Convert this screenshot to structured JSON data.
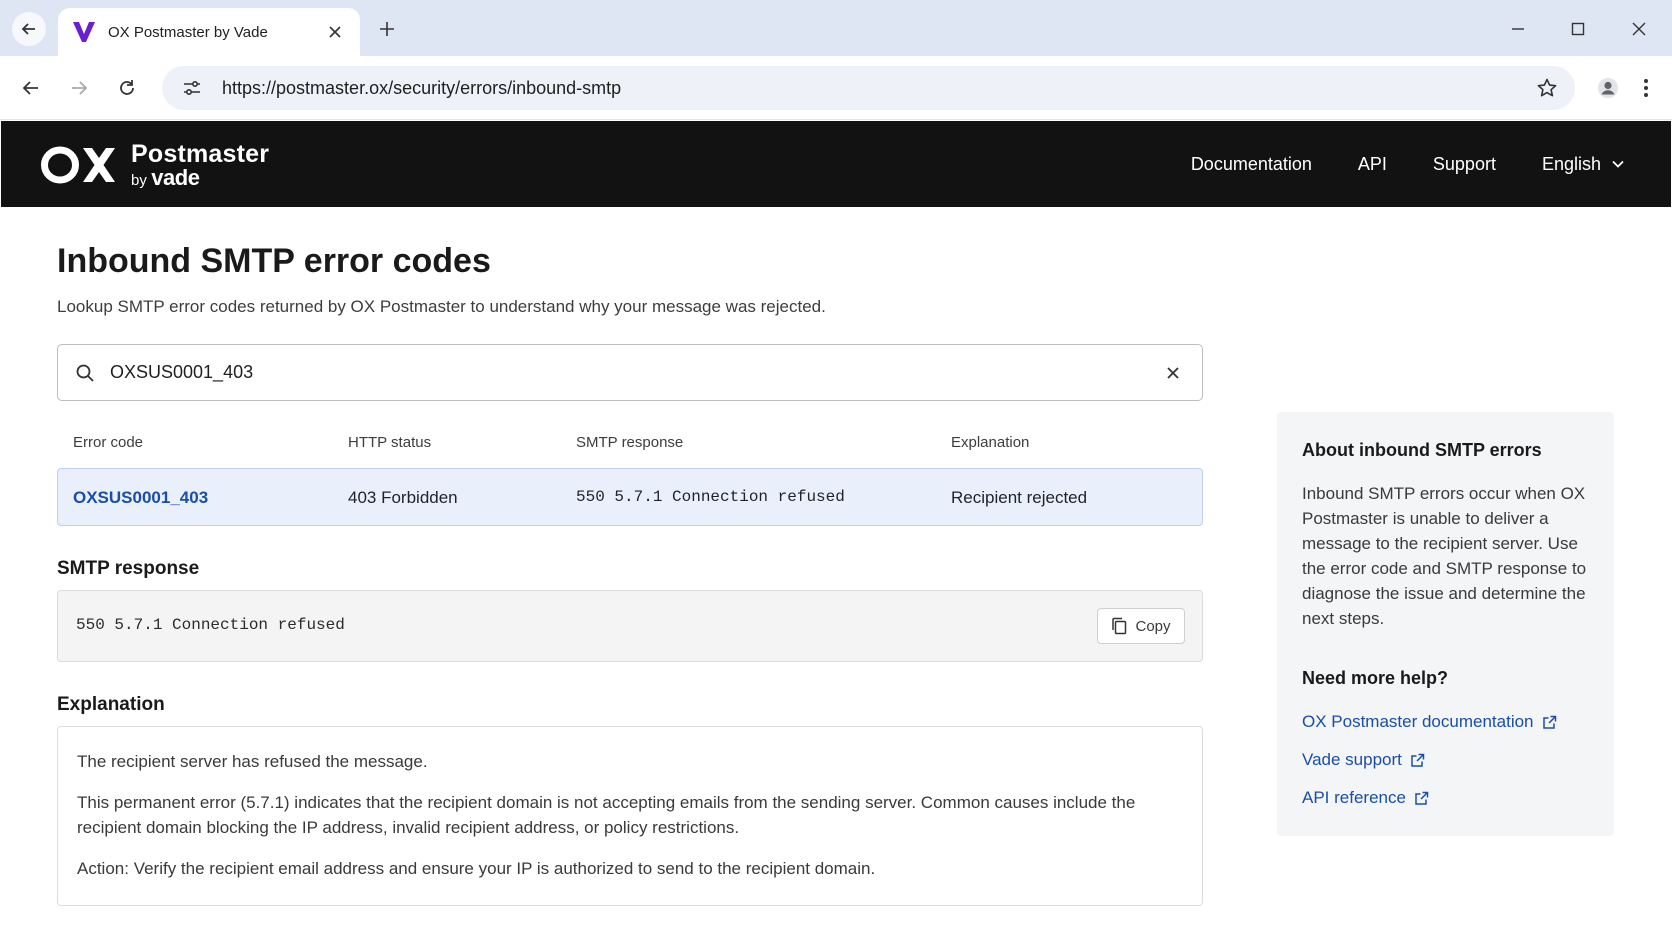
{
  "browser": {
    "tab_title": "OX Postmaster by Vade",
    "url": "https://postmaster.ox/security/errors/inbound-smtp"
  },
  "header": {
    "logo_mark": "OX",
    "logo_product": "Postmaster",
    "logo_by": "by",
    "logo_vendor": "vade",
    "nav": [
      "Documentation",
      "API",
      "Support"
    ],
    "language": "English"
  },
  "main": {
    "title": "Inbound SMTP error codes",
    "subtitle": "Lookup SMTP error codes returned by OX Postmaster to understand why your message was rejected.",
    "search_value": "OXSUS0001_403",
    "table": {
      "columns": [
        "Error code",
        "HTTP status",
        "SMTP response",
        "Explanation"
      ],
      "rows": [
        [
          "OXSUS0001_403",
          "403 Forbidden",
          "550 5.7.1 Connection refused",
          "Recipient rejected"
        ]
      ]
    },
    "smtp_section": {
      "heading": "SMTP response",
      "text": "550 5.7.1 Connection refused",
      "copy_label": "Copy"
    },
    "explanation_section": {
      "heading": "Explanation",
      "paragraphs": [
        "The recipient server has refused the message.",
        "This permanent error (5.7.1) indicates that the recipient domain is not accepting emails from the sending server. Common causes include the recipient domain blocking the IP address, invalid recipient address, or policy restrictions.",
        "Action: Verify the recipient email address and ensure your IP is authorized to send to the recipient domain."
      ]
    }
  },
  "sidebar": {
    "heading": "About inbound SMTP errors",
    "body": "Inbound SMTP errors occur when OX Postmaster is unable to deliver a message to the recipient server. Use the error code and SMTP response to diagnose the issue and determine the next steps.",
    "help_heading": "Need more help?",
    "links": [
      "OX Postmaster documentation",
      "Vade support",
      "API reference"
    ]
  },
  "colors": {
    "header_bg": "#121212",
    "link": "#1a4ea6",
    "row_highlight": "#e9f0fb",
    "favicon": "#6a1fd0"
  }
}
